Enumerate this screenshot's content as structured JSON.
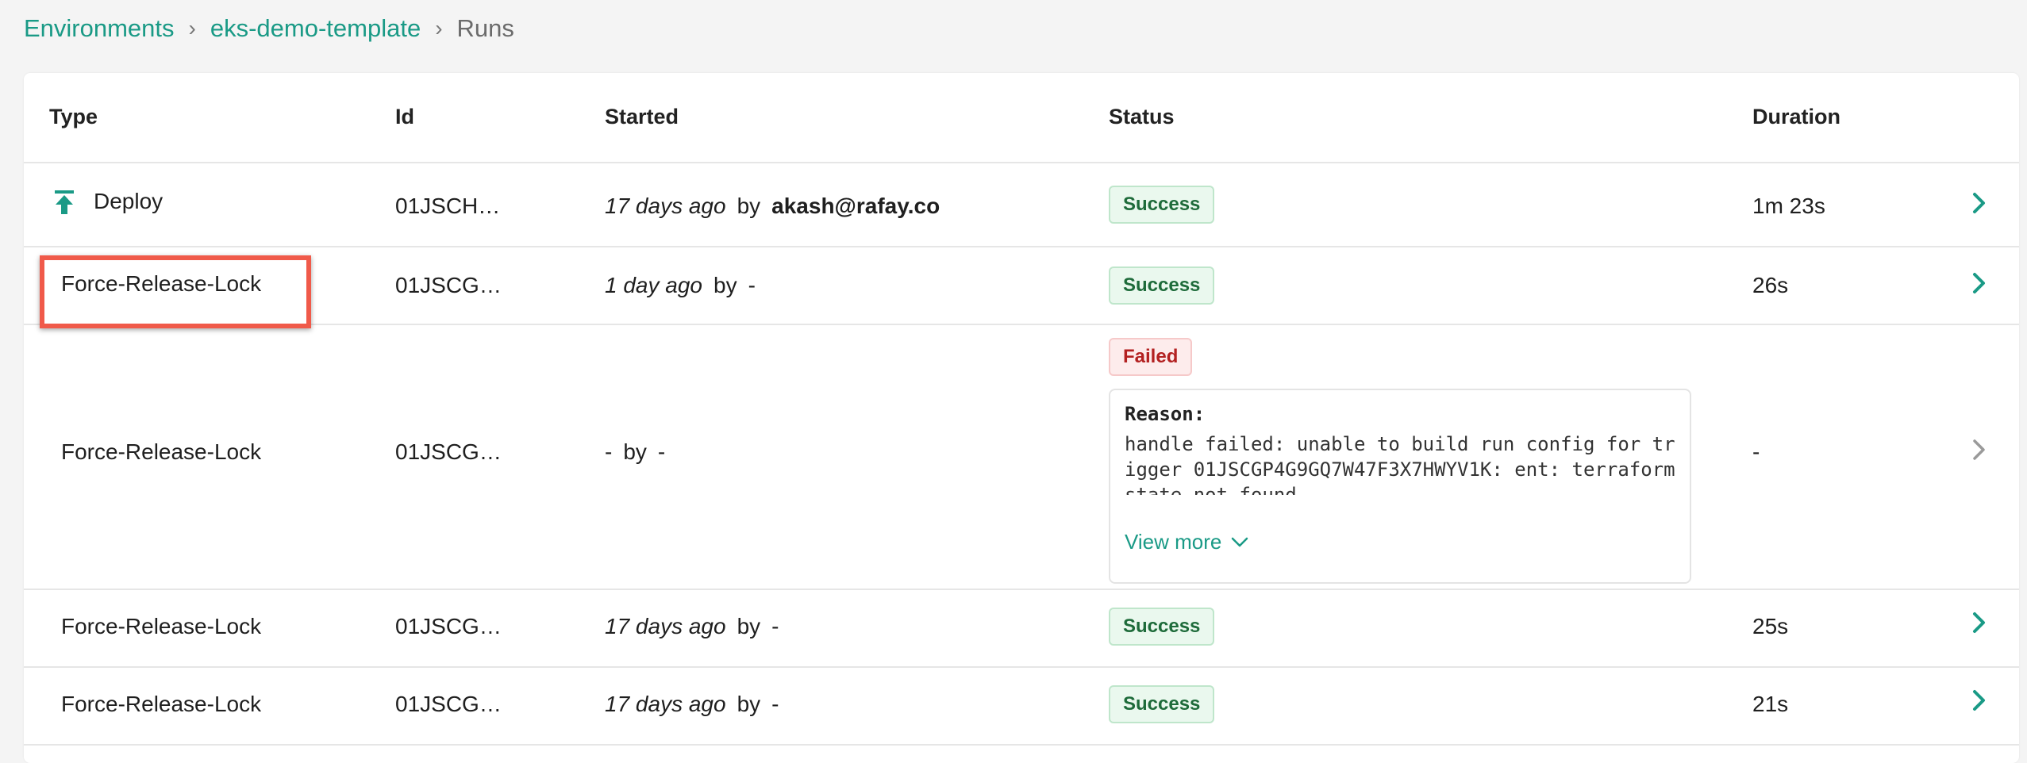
{
  "breadcrumb": {
    "items": [
      "Environments",
      "eks-demo-template"
    ],
    "separator": "›",
    "current": "Runs"
  },
  "table": {
    "headers": {
      "type": "Type",
      "id": "Id",
      "started": "Started",
      "status": "Status",
      "duration": "Duration"
    },
    "rows": [
      {
        "type": "Deploy",
        "id": "01JSCH…",
        "started_ago": "17 days ago",
        "by": "by",
        "user": "akash@rafay.co",
        "status": "Success",
        "duration": "1m 23s"
      },
      {
        "type": "Force-Release-Lock",
        "id": "01JSCG…",
        "started_ago": "1   day ago",
        "by": "by",
        "user": "-",
        "status": "Success",
        "duration": "26s"
      },
      {
        "type": "Force-Release-Lock",
        "id": "01JSCG…",
        "started_ago": "-",
        "by": "by",
        "user": "-",
        "status": "Failed",
        "duration": "-",
        "reason_title": "Reason:",
        "reason_text": "handle failed: unable to build run config for trigger 01JSCGP4G9GQ7W47F3X7HWYV1K: ent: terraform state not found",
        "view_more": "View more"
      },
      {
        "type": "Force-Release-Lock",
        "id": "01JSCG…",
        "started_ago": "17 days ago",
        "by": "by",
        "user": "-",
        "status": "Success",
        "duration": "25s"
      },
      {
        "type": "Force-Release-Lock",
        "id": "01JSCG…",
        "started_ago": "17 days ago",
        "by": "by",
        "user": "-",
        "status": "Success",
        "duration": "21s"
      }
    ]
  },
  "colors": {
    "accent": "#1a9a86",
    "success_text": "#1e6b3a",
    "failed_text": "#b32121",
    "highlight": "#f05a4a"
  },
  "icons": {
    "deploy": "upload-arrow-icon",
    "row_chevron": "chevron-right-icon",
    "view_more": "chevron-down-icon"
  }
}
